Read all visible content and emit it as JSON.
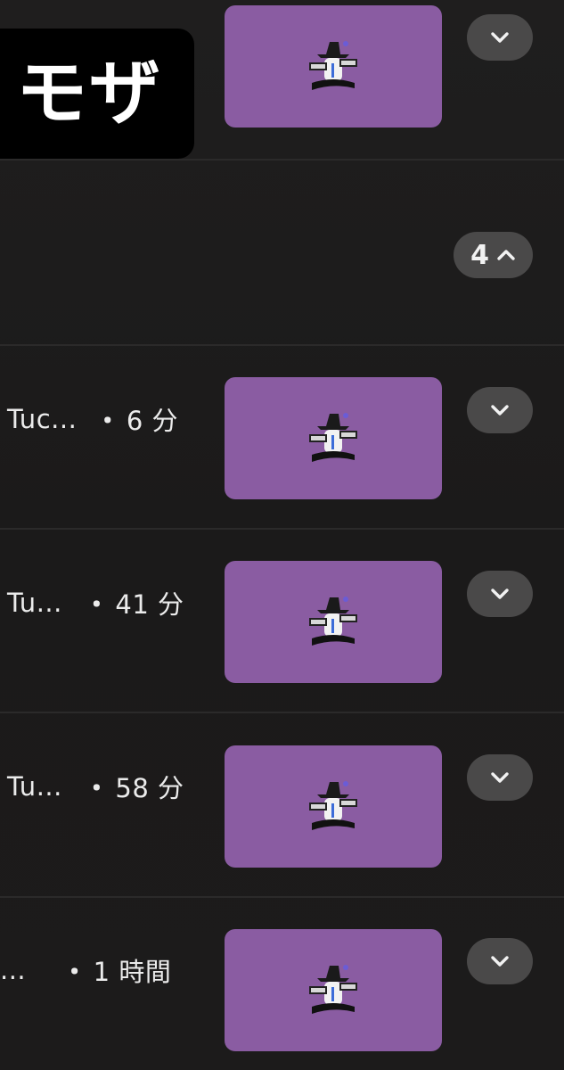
{
  "label": {
    "text": "モザ"
  },
  "group": {
    "count": "4"
  },
  "items": [
    {
      "title": "",
      "separator": "",
      "time": ""
    },
    {
      "title": "Tuc...",
      "separator": "・",
      "time": "6 分"
    },
    {
      "title": "Tu...",
      "separator": "・",
      "time": "41 分"
    },
    {
      "title": "Tu...",
      "separator": "・",
      "time": "58 分"
    },
    {
      "title": "...",
      "separator": "・",
      "time": "1 時間"
    }
  ],
  "icons": {
    "thumbnail": "wizard-character-thumbnail",
    "expand": "chevron-down-icon",
    "collapse": "chevron-up-icon"
  },
  "colors": {
    "background": "#1b1a1a",
    "thumbnail": "#8a5ca2",
    "pill": "#4a4949",
    "label_bg": "#000000"
  }
}
